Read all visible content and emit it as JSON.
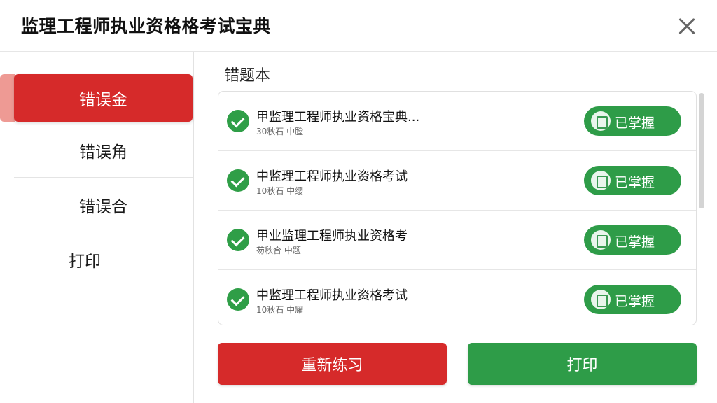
{
  "window": {
    "title": "监理工程师执业资格格考试宝典"
  },
  "sidebar": {
    "items": [
      {
        "label": "错误金",
        "active": true
      },
      {
        "label": "错误角",
        "active": false
      },
      {
        "label": "错误合",
        "active": false
      },
      {
        "label": "打印",
        "active": false
      }
    ]
  },
  "main": {
    "section_title": "错题本",
    "rows": [
      {
        "title": "甲监理工程师执业资格宝典...",
        "meta": "30秋石 中膛",
        "status": "已掌握"
      },
      {
        "title": "中监理工程师执业资格考试",
        "meta": "10秋石 中缨",
        "status": "已掌握"
      },
      {
        "title": "甲业监理工程师执业资格考",
        "meta": "芴秋合 中题",
        "status": "已掌握"
      },
      {
        "title": "中监理工程师执业资格考试",
        "meta": "10秋石 中耀",
        "status": "已掌握"
      }
    ]
  },
  "actions": {
    "retry_label": "重新练习",
    "print_label": "打印"
  },
  "colors": {
    "accent_red": "#d62a2a",
    "accent_green": "#2e9c48"
  },
  "icons": {
    "close": "close-icon",
    "check": "check-circle-icon",
    "mastered": "clipboard-icon"
  }
}
